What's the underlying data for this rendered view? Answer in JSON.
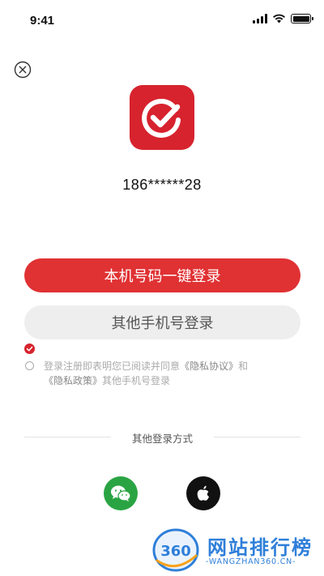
{
  "status_bar": {
    "time": "9:41"
  },
  "account": {
    "masked_phone": "186******28"
  },
  "actions": {
    "one_click_login": "本机号码一键登录",
    "other_phone_login": "其他手机号登录"
  },
  "agreement": {
    "prefix": "登录注册即表明您已阅读并同意",
    "privacy_agreement": "《隐私协议》",
    "conjunction": "和",
    "privacy_policy": "《隐私政策》",
    "suffix": "其他手机号登录"
  },
  "other_login": {
    "label": "其他登录方式",
    "options": [
      "wechat-icon",
      "apple-icon"
    ]
  },
  "watermark": {
    "number": "360",
    "title": "网站排行榜",
    "subtitle": "-WANGZHAN360.CN-"
  },
  "colors": {
    "brand_red": "#d7232e",
    "primary_button": "#e03133",
    "secondary_button": "#eeeeee",
    "wechat_green": "#2aa443",
    "apple_black": "#111111",
    "watermark_blue": "#2f7fd9"
  }
}
